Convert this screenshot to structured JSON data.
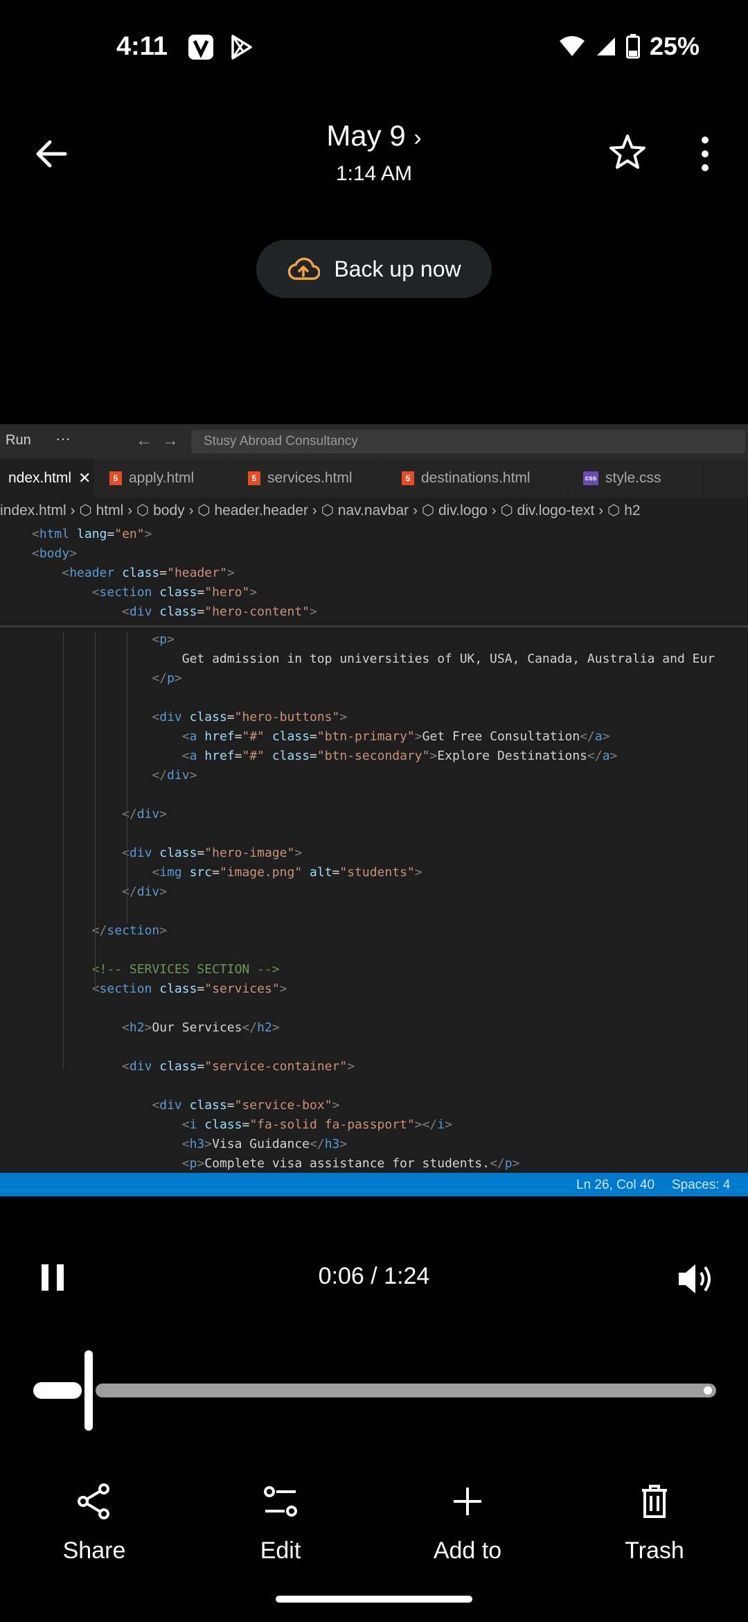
{
  "status_bar": {
    "time": "4:11",
    "battery": "25%"
  },
  "header": {
    "date": "May 9",
    "time": "1:14 AM"
  },
  "backup_button": {
    "label": "Back up now"
  },
  "ide": {
    "toolbar": {
      "run": "Run",
      "more": "···",
      "search": "Stusy Abroad Consultancy"
    },
    "tabs": [
      {
        "label": "ndex.html",
        "icon": "html"
      },
      {
        "label": "apply.html",
        "icon": "html"
      },
      {
        "label": "services.html",
        "icon": "html"
      },
      {
        "label": "destinations.html",
        "icon": "html"
      },
      {
        "label": "style.css",
        "icon": "css"
      }
    ],
    "breadcrumb": [
      "index.html",
      "html",
      "body",
      "header.header",
      "nav.navbar",
      "div.logo",
      "div.logo-text",
      "h2"
    ],
    "code_lines": [
      "<html lang=\"en\">",
      "<body>",
      "    <header class=\"header\">",
      "        <section class=\"hero\">",
      "            <div class=\"hero-content\">",
      "                <p>",
      "                    Get admission in top universities of UK, USA, Canada, Australia and Eur",
      "                </p>",
      "",
      "                <div class=\"hero-buttons\">",
      "                    <a href=\"#\" class=\"btn-primary\">Get Free Consultation</a>",
      "                    <a href=\"#\" class=\"btn-secondary\">Explore Destinations</a>",
      "                </div>",
      "",
      "            </div>",
      "",
      "            <div class=\"hero-image\">",
      "                <img src=\"image.png\" alt=\"students\">",
      "            </div>",
      "",
      "        </section>",
      "",
      "        <!-- SERVICES SECTION -->",
      "        <section class=\"services\">",
      "",
      "            <h2>Our Services</h2>",
      "",
      "            <div class=\"service-container\">",
      "",
      "                <div class=\"service-box\">",
      "                    <i class=\"fa-solid fa-passport\"></i>",
      "                    <h3>Visa Guidance</h3>",
      "                    <p>Complete visa assistance for students.</p>"
    ],
    "status": {
      "position": "Ln 26, Col 40",
      "spaces": "Spaces: 4"
    }
  },
  "player": {
    "time": "0:06 / 1:24",
    "progress": 0.07
  },
  "actions": [
    {
      "label": "Share",
      "icon": "share-icon"
    },
    {
      "label": "Edit",
      "icon": "edit-icon"
    },
    {
      "label": "Add to",
      "icon": "add-icon"
    },
    {
      "label": "Trash",
      "icon": "trash-icon"
    }
  ]
}
